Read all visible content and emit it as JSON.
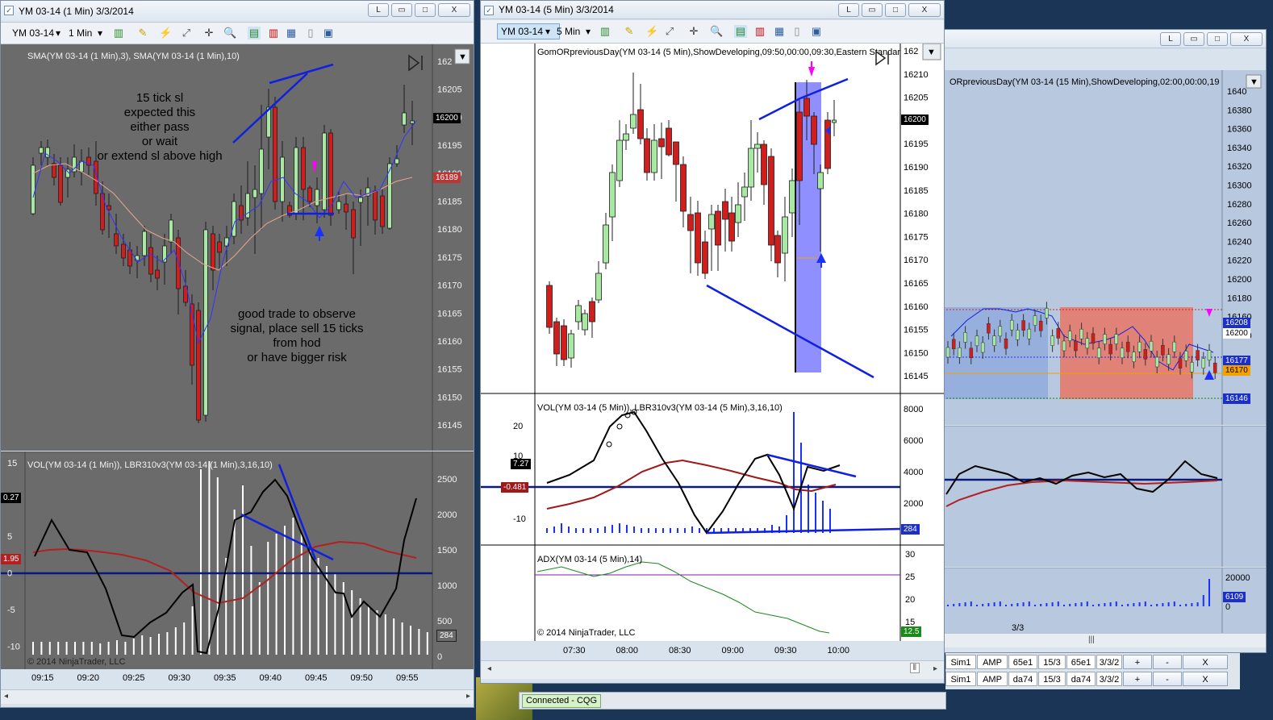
{
  "windows": {
    "left": {
      "title": "YM 03-14 (1 Min)  3/3/2014",
      "instrument": "YM 03-14",
      "interval": "1 Min",
      "price_indicator_label": "SMA(YM 03-14 (1 Min),3), SMA(YM 03-14 (1 Min),10)",
      "volume_indicator_label": "VOL(YM 03-14 (1 Min)), LBR310v3(YM 03-14 (1 Min),3,16,10)",
      "price_axis": [
        "162",
        "16205",
        "16200",
        "16195",
        "16190",
        "16185",
        "16180",
        "16175",
        "16170",
        "16165",
        "16160",
        "16155",
        "16150",
        "16145"
      ],
      "price_tags": {
        "last": "16200",
        "sma": "16189"
      },
      "osc_axis_left": [
        "15",
        "10",
        "5",
        "0",
        "-5",
        "-10"
      ],
      "vol_axis_right": [
        "2500",
        "2000",
        "1500",
        "1000",
        "500",
        "0"
      ],
      "osc_tags": {
        "fast": "0.27",
        "slow": "1.95",
        "vol": "284"
      },
      "time_axis": [
        "09:15",
        "09:20",
        "09:25",
        "09:30",
        "09:35",
        "09:40",
        "09:45",
        "09:50",
        "09:55"
      ],
      "copyright": "© 2014 NinjaTrader, LLC",
      "annotation_top": "15 tick sl\nexpected this\neither pass\nor wait\nor extend  sl above high",
      "annotation_bottom": "good trade to observe\nsignal, place sell 15 ticks\nfrom hod\nor have bigger risk"
    },
    "middle": {
      "title": "YM 03-14 (5 Min)  3/3/2014",
      "instrument": "YM 03-14",
      "interval": "5 Min",
      "price_indicator_label": "GomORpreviousDay(YM 03-14 (5 Min),ShowDeveloping,09:50,00:00,09:30,Eastern Standar",
      "price_axis": [
        "162",
        "16210",
        "16205",
        "16200",
        "16195",
        "16190",
        "16185",
        "16180",
        "16175",
        "16170",
        "16165",
        "16160",
        "16155",
        "16150",
        "16145"
      ],
      "price_tag_last": "16200",
      "volume_indicator_label": "VOL(YM 03-14 (5 Min)), LBR310v3(YM 03-14 (5 Min),3,16,10)",
      "vol_axis_right": [
        "8000",
        "6000",
        "4000",
        "2000"
      ],
      "osc_axis_left": [
        "20",
        "10",
        "-10"
      ],
      "osc_tags": {
        "fast": "7.27",
        "slow": "-0.481",
        "vol": "284"
      },
      "adx_label": "ADX(YM 03-14 (5 Min),14)",
      "adx_axis": [
        "30",
        "25",
        "20",
        "15"
      ],
      "adx_tag": "12.5",
      "copyright": "© 2014 NinjaTrader, LLC",
      "time_axis": [
        "07:30",
        "08:00",
        "08:30",
        "09:00",
        "09:30",
        "10:00"
      ]
    },
    "right": {
      "price_indicator_label": "ORpreviousDay(YM 03-14 (15 Min),ShowDeveloping,02:00,00:00,19",
      "price_axis": [
        "1640",
        "16380",
        "16360",
        "16340",
        "16320",
        "16300",
        "16280",
        "16260",
        "16240",
        "16220",
        "16200",
        "16180",
        "16160",
        "16140"
      ],
      "price_tags": {
        "a": "16208",
        "b": "16200",
        "c": "16177",
        "d": "16170",
        "e": "16146"
      },
      "vol_axis": [
        "20000",
        "0"
      ],
      "vol_tag": "6109",
      "time_axis": [
        "3/3"
      ]
    }
  },
  "window_buttons": {
    "pin": "L",
    "minimize": "▭",
    "maximize": "□",
    "close": "X"
  },
  "status": {
    "connection": "Connected - CQG"
  },
  "orders": {
    "rows": [
      [
        "Sim1",
        "AMP",
        "65e1",
        "15/3",
        "65e1",
        "3/3/2"
      ],
      [
        "Sim1",
        "AMP",
        "da74",
        "15/3",
        "da74",
        "3/3/2"
      ]
    ],
    "buttons": [
      "+",
      "-",
      "X"
    ]
  }
}
